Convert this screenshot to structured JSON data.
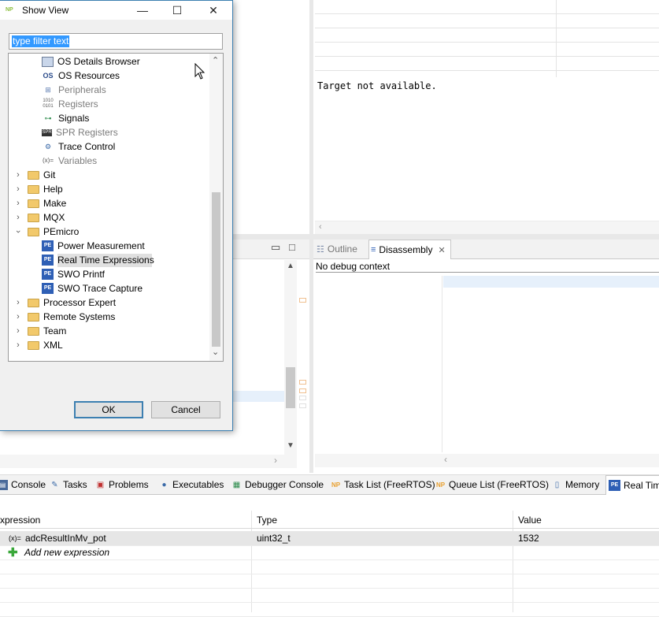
{
  "dialog": {
    "title": "Show View",
    "filter_value": "type filter text",
    "ok_label": "OK",
    "cancel_label": "Cancel",
    "tree": [
      {
        "label": "OS Details Browser",
        "icon": "os-details-icon",
        "enabled": true
      },
      {
        "label": "OS Resources",
        "icon": "os-resources-icon",
        "enabled": true
      },
      {
        "label": "Peripherals",
        "icon": "peripherals-icon",
        "enabled": false
      },
      {
        "label": "Registers",
        "icon": "registers-icon",
        "enabled": false
      },
      {
        "label": "Signals",
        "icon": "signals-icon",
        "enabled": true
      },
      {
        "label": "SPR Registers",
        "icon": "spr-registers-icon",
        "enabled": false
      },
      {
        "label": "Trace Control",
        "icon": "trace-control-icon",
        "enabled": true
      },
      {
        "label": "Variables",
        "icon": "variables-icon",
        "enabled": false
      },
      {
        "label": "Git",
        "icon": "folder-icon"
      },
      {
        "label": "Help",
        "icon": "folder-icon"
      },
      {
        "label": "Make",
        "icon": "folder-icon"
      },
      {
        "label": "MQX",
        "icon": "folder-icon"
      },
      {
        "label": "PEmicro",
        "icon": "folder-icon",
        "expanded": true
      },
      {
        "label": "Power Measurement",
        "icon": "pemicro-icon"
      },
      {
        "label": "Real Time Expressions",
        "icon": "pemicro-icon",
        "selected": true
      },
      {
        "label": "SWO Printf",
        "icon": "pemicro-icon"
      },
      {
        "label": "SWO Trace Capture",
        "icon": "pemicro-icon"
      },
      {
        "label": "Processor Expert",
        "icon": "folder-icon"
      },
      {
        "label": "Remote Systems",
        "icon": "folder-icon"
      },
      {
        "label": "Team",
        "icon": "folder-icon"
      },
      {
        "label": "XML",
        "icon": "folder-icon"
      }
    ],
    "icon_texts": {
      "os_details": "",
      "os_resources": "OS",
      "registers": "1010\n0101",
      "spr": "SPR",
      "variables": "(x)=",
      "pe": "PE"
    }
  },
  "editor": {
    "target_message": "Target not available.",
    "no_debug_context": "No debug context",
    "outline_tab": "Outline",
    "disassembly_tab": "Disassembly"
  },
  "bottom_tabs": [
    {
      "label": "Console",
      "icon": "console-icon"
    },
    {
      "label": "Tasks",
      "icon": "tasks-icon"
    },
    {
      "label": "Problems",
      "icon": "problems-icon"
    },
    {
      "label": "Executables",
      "icon": "executables-icon"
    },
    {
      "label": "Debugger Console",
      "icon": "debugger-console-icon"
    },
    {
      "label": "Task List (FreeRTOS)",
      "icon": "nxp-icon"
    },
    {
      "label": "Queue List (FreeRTOS)",
      "icon": "nxp-icon"
    },
    {
      "label": "Memory",
      "icon": "memory-icon"
    },
    {
      "label": "Real Tim",
      "icon": "pemicro-icon",
      "active": true
    }
  ],
  "expressions": {
    "headers": {
      "expression": "xpression",
      "type": "Type",
      "value": "Value"
    },
    "rows": [
      {
        "name": "adcResultInMv_pot",
        "prefix": "(x)=",
        "type": "uint32_t",
        "value": "1532"
      }
    ],
    "add_label": "Add new expression"
  },
  "colors": {
    "accent": "#3c7fb1",
    "selection": "#3399ff",
    "pemicro": "#2e5fb5",
    "folder": "#f2c96b"
  }
}
